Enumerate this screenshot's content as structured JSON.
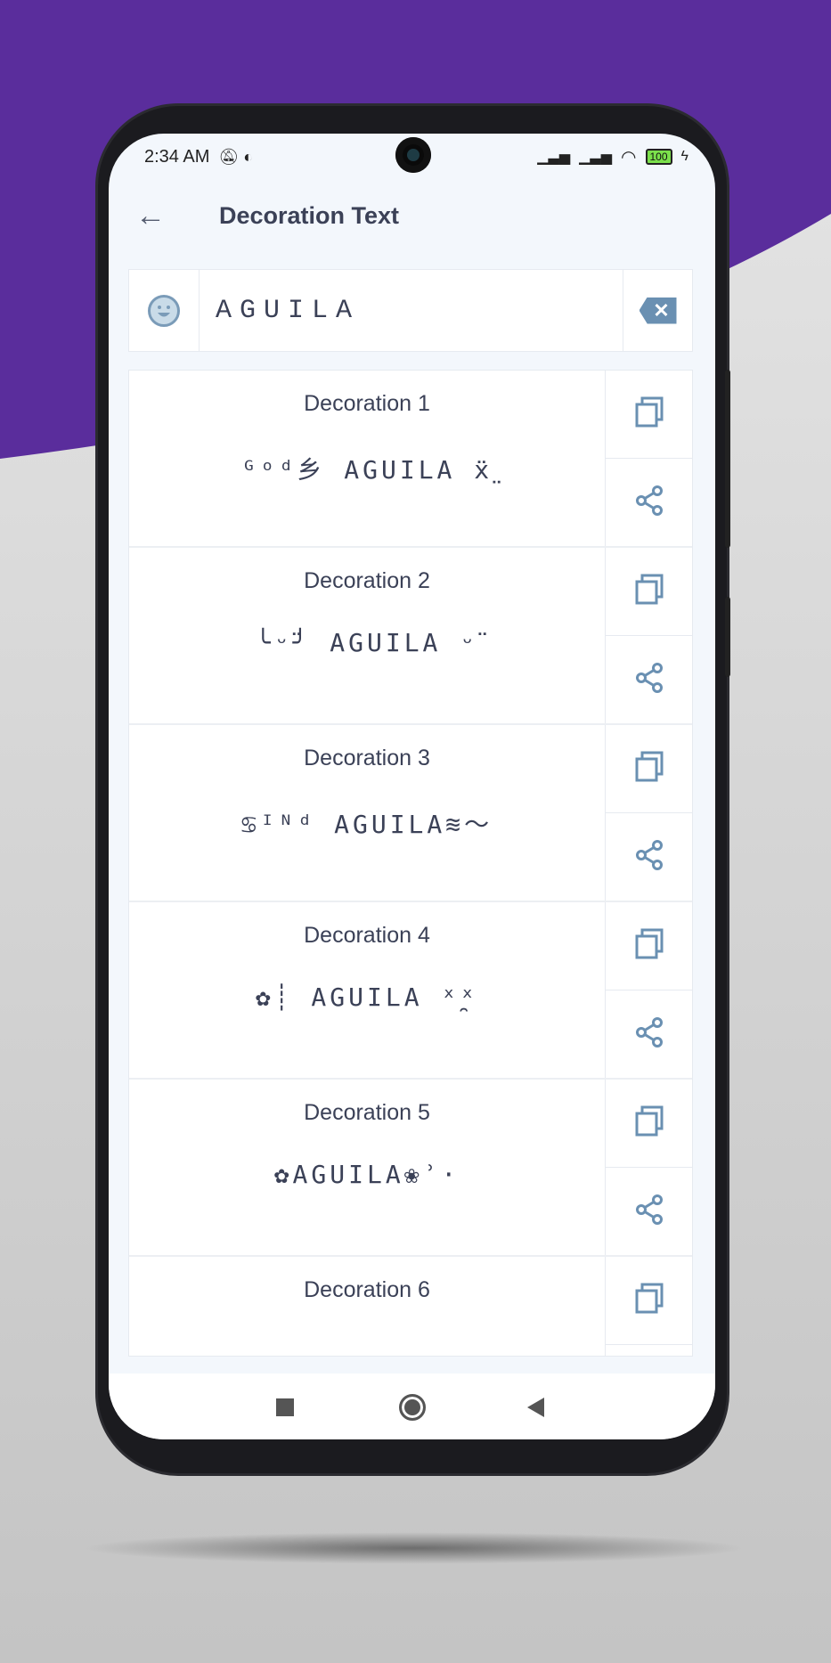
{
  "colors": {
    "purple": "#5a2d9c",
    "icon": "#6a90b2",
    "text": "#3b4157"
  },
  "status": {
    "time": "2:34 AM",
    "battery": "100"
  },
  "appbar": {
    "title": "Decoration Text",
    "back_icon": "arrow-left-icon"
  },
  "input": {
    "value": "AGUILA",
    "emoji_icon": "smiley-icon",
    "clear_icon": "backspace-icon"
  },
  "decorations": [
    {
      "name": "Decoration 1",
      "text": "ᴳᵒᵈ乡 AGUILA ẍ̤"
    },
    {
      "name": "Decoration 2",
      "text": "╰ᵕ̈╯ AGUILA ᵕ̈"
    },
    {
      "name": "Decoration 3",
      "text": "♋ᴵᴺᵈ  AGUILA≋〜"
    },
    {
      "name": "Decoration 4",
      "text": "✿┊ AGUILA ˣ̯ˣ"
    },
    {
      "name": "Decoration 5",
      "text": "✿AGUILA❀ʾ·"
    },
    {
      "name": "Decoration 6",
      "text": ""
    }
  ],
  "actions": {
    "copy_icon": "copy-icon",
    "share_icon": "share-icon"
  },
  "navbar": {
    "recent": "square-icon",
    "home": "circle-icon",
    "back": "triangle-back-icon"
  }
}
